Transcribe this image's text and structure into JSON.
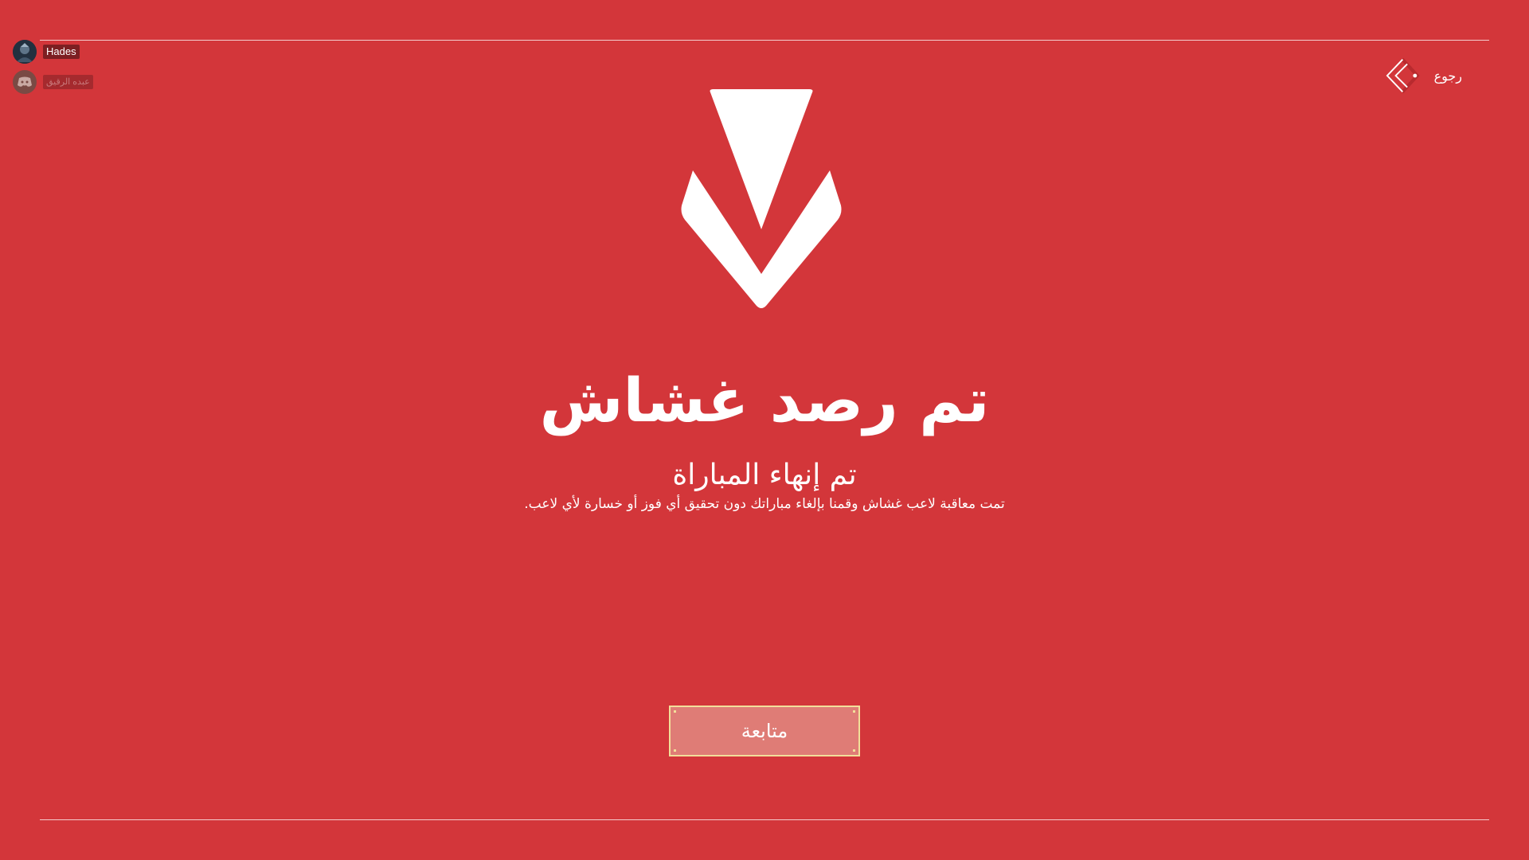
{
  "friends": [
    {
      "name": "Hades",
      "icon": "player-avatar"
    },
    {
      "name": "عبده الرقيق",
      "icon": "discord-icon"
    }
  ],
  "back": {
    "label": "رجوع",
    "icon": "back-chevron-icon"
  },
  "logo": {
    "icon": "valorant-logo-icon"
  },
  "title": "تم رصد غشاش",
  "subtitle": "تم إنهاء المباراة",
  "description": "تمت معاقبة لاعب غشاش وقمنا بإلغاء مباراتك دون تحقيق أي فوز أو خسارة لأي لاعب.",
  "continue_button": {
    "label": "متابعة"
  },
  "colors": {
    "background": "#d3363a",
    "button_fill": "#df7c76",
    "button_border": "#f2df9a",
    "text": "#ffffff"
  }
}
